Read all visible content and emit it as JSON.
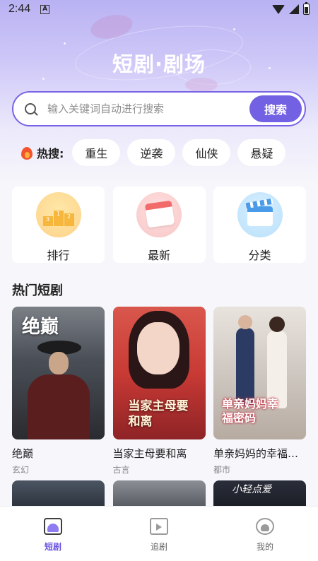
{
  "status_bar": {
    "time": "2:44",
    "notification_icon": "A"
  },
  "header": {
    "title": "短剧·剧场"
  },
  "search": {
    "placeholder": "输入关键词自动进行搜索",
    "button_label": "搜索"
  },
  "hot_search": {
    "label": "热搜:",
    "chips": [
      "重生",
      "逆袭",
      "仙侠",
      "悬疑"
    ]
  },
  "categories": [
    {
      "label": "排行",
      "icon": "podium-icon"
    },
    {
      "label": "最新",
      "icon": "calendar-icon"
    },
    {
      "label": "分类",
      "icon": "clapperboard-icon"
    }
  ],
  "hot_dramas": {
    "title": "热门短剧",
    "items": [
      {
        "name": "绝巅",
        "genre": "玄幻",
        "poster_text": "绝巅"
      },
      {
        "name": "当家主母要和离",
        "genre": "古言",
        "poster_text": "当家主母要和离"
      },
      {
        "name": "单亲妈妈的幸福密码",
        "genre": "都市",
        "poster_text": "单亲妈妈幸福密码"
      }
    ],
    "next_row_poster_text": "小轻点爱"
  },
  "tab_bar": {
    "tabs": [
      {
        "label": "短剧",
        "icon": "home-tv-icon",
        "active": true
      },
      {
        "label": "追剧",
        "icon": "tv-play-icon",
        "active": false
      },
      {
        "label": "我的",
        "icon": "profile-icon",
        "active": false
      }
    ]
  },
  "colors": {
    "accent": "#7361e4",
    "hot_flame": "#f2542d"
  }
}
